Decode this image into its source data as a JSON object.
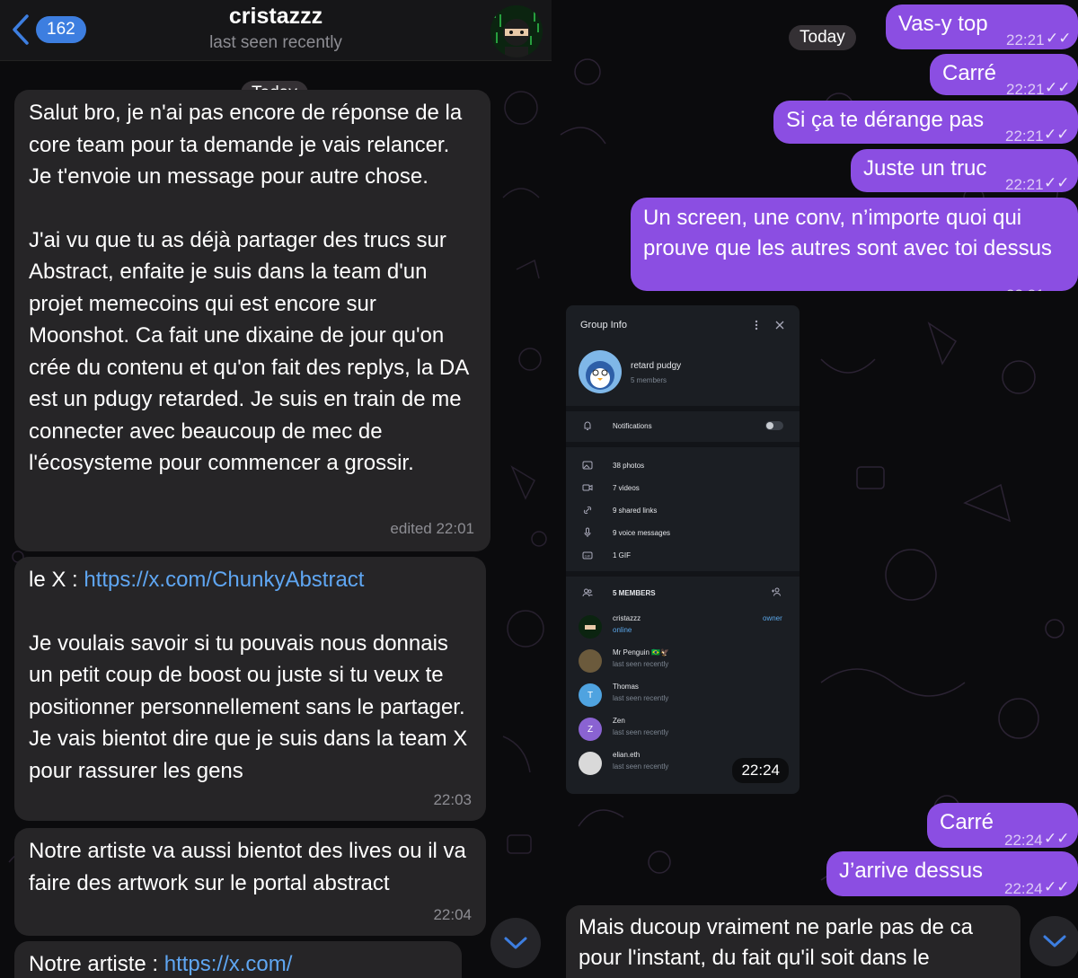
{
  "left": {
    "header": {
      "back_count": "162",
      "title": "cristazzz",
      "status": "last seen recently"
    },
    "date_label": "Today",
    "messages": [
      {
        "paragraphs": [
          "Salut bro, je n'ai pas encore de réponse de la core team pour ta demande je vais relancer.  Je t'envoie un message pour autre chose.",
          "J'ai vu que tu as déjà partager des trucs sur Abstract, enfaite je suis dans la team d'un projet memecoins qui est encore sur Moonshot. Ca fait une dixaine de jour qu'on crée du contenu et qu'on fait des replys, la DA est un pdugy retarded. Je suis en train de me connecter avec beaucoup de mec de l'écosysteme pour commencer a grossir."
        ],
        "time": "edited 22:01"
      },
      {
        "prefix": "le X : ",
        "link": "https://x.com/ChunkyAbstract",
        "body": "Je voulais savoir si tu pouvais nous donnais un petit coup de boost ou  juste si tu veux te positionner personnellement sans le partager. Je vais bientot dire que je suis dans la team X pour rassurer les gens",
        "time": "22:03"
      },
      {
        "body": "Notre artiste va aussi bientot des lives ou il va faire des artwork sur le portal abstract",
        "time": "22:04"
      },
      {
        "prefix": "Notre artiste : ",
        "link": "https://x.com/"
      }
    ]
  },
  "right": {
    "date_label": "Today",
    "messages_top": [
      {
        "text": "Vas-y top",
        "time": "22:21"
      },
      {
        "text": "Carré",
        "time": "22:21"
      },
      {
        "text": "Si ça te dérange pas",
        "time": "22:21"
      },
      {
        "text": "Juste un truc",
        "time": "22:21"
      },
      {
        "text": "Un screen, une conv, n’importe quoi qui prouve que les autres sont avec toi dessus",
        "time": "22:21"
      }
    ],
    "screenshot": {
      "title": "Group Info",
      "group_name": "retard pudgy",
      "group_members": "5 members",
      "notifications": "Notifications",
      "media": [
        "38 photos",
        "7 videos",
        "9 shared links",
        "9 voice messages",
        "1 GIF"
      ],
      "members_header": "5 MEMBERS",
      "members": [
        {
          "name": "cristazzz",
          "status": "online",
          "role": "owner",
          "initial": ""
        },
        {
          "name": "Mr Penguin 🇧🇷🦅",
          "status": "last seen recently",
          "role": "",
          "initial": ""
        },
        {
          "name": "Thomas",
          "status": "last seen recently",
          "role": "",
          "initial": "T"
        },
        {
          "name": "Zen",
          "status": "last seen recently",
          "role": "",
          "initial": "Z"
        },
        {
          "name": "elian.eth",
          "status": "last seen recently",
          "role": "",
          "initial": ""
        }
      ],
      "time": "22:24"
    },
    "messages_bottom": [
      {
        "text": "Carré",
        "time": "22:24"
      },
      {
        "text": "J’arrive dessus",
        "time": "22:24"
      }
    ],
    "incoming": "Mais ducoup vraiment ne parle pas de ca pour l'instant, du fait qu'il soit dans le"
  },
  "colors": {
    "outgoing_bubble": "#8b4ee2",
    "incoming_bubble": "#262527",
    "link": "#5fa6f2",
    "badge": "#3d7ee0"
  },
  "icons": [
    "chevron-left-icon",
    "chevron-down-icon",
    "double-check-icon",
    "bell-icon",
    "photo-icon",
    "video-icon",
    "link-icon",
    "mic-icon",
    "gif-icon",
    "members-icon",
    "add-member-icon",
    "more-icon",
    "close-icon"
  ]
}
